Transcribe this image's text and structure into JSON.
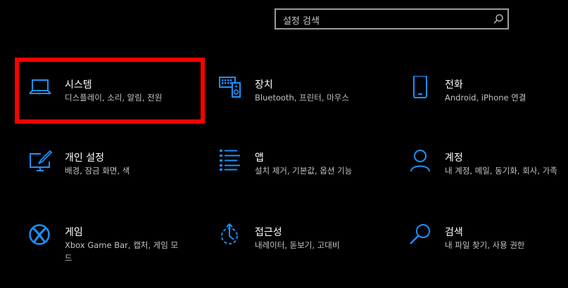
{
  "search": {
    "placeholder": "설정 검색"
  },
  "colors": {
    "accent": "#1e90ff",
    "highlight_border": "#ff0000",
    "background": "#000000"
  },
  "tiles": [
    {
      "icon": "laptop-icon",
      "title": "시스템",
      "desc": "디스플레이, 소리, 알림, 전원"
    },
    {
      "icon": "keyboard-speaker-icon",
      "title": "장치",
      "desc": "Bluetooth, 프린터, 마우스"
    },
    {
      "icon": "phone-icon",
      "title": "전화",
      "desc": "Android, iPhone 연결"
    },
    {
      "icon": "personalization-icon",
      "title": "개인 설정",
      "desc": "배경, 잠금 화면, 색"
    },
    {
      "icon": "apps-list-icon",
      "title": "앱",
      "desc": "설치 제거, 기본값, 옵션 기능"
    },
    {
      "icon": "person-icon",
      "title": "계정",
      "desc": "내 계정, 메일, 동기화, 회사, 가족"
    },
    {
      "icon": "xbox-icon",
      "title": "게임",
      "desc": "Xbox Game Bar, 캡처, 게임 모드"
    },
    {
      "icon": "ease-of-access-icon",
      "title": "접근성",
      "desc": "내레이터, 돋보기, 고대비"
    },
    {
      "icon": "magnifier-icon",
      "title": "검색",
      "desc": "내 파일 찾기, 사용 권한"
    }
  ]
}
